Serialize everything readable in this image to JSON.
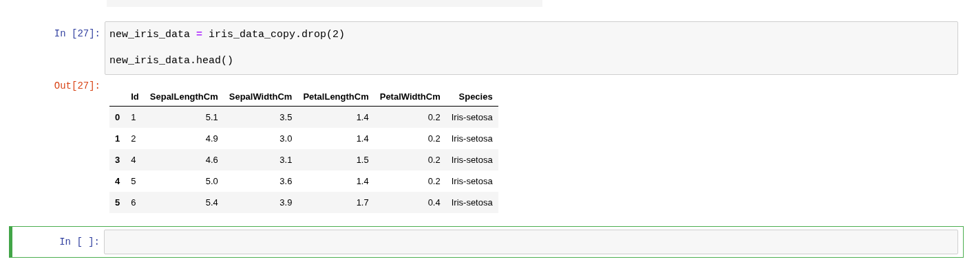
{
  "cells": [
    {
      "kind": "output_fragment"
    },
    {
      "kind": "code",
      "prompt": "In [27]:",
      "selected": false,
      "lines": [
        [
          {
            "text": "new_iris_data ",
            "kind": "name"
          },
          {
            "text": "=",
            "kind": "operator"
          },
          {
            "text": " iris_data_copy.drop(2)",
            "kind": "name"
          }
        ],
        [
          {
            "text": "new_iris_data.head()",
            "kind": "name"
          }
        ]
      ],
      "output": {
        "prompt": "Out[27]:",
        "columns": [
          "",
          "Id",
          "SepalLengthCm",
          "SepalWidthCm",
          "PetalLengthCm",
          "PetalWidthCm",
          "Species"
        ],
        "rows": [
          [
            "0",
            "1",
            "5.1",
            "3.5",
            "1.4",
            "0.2",
            "Iris-setosa"
          ],
          [
            "1",
            "2",
            "4.9",
            "3.0",
            "1.4",
            "0.2",
            "Iris-setosa"
          ],
          [
            "3",
            "4",
            "4.6",
            "3.1",
            "1.5",
            "0.2",
            "Iris-setosa"
          ],
          [
            "4",
            "5",
            "5.0",
            "3.6",
            "1.4",
            "0.2",
            "Iris-setosa"
          ],
          [
            "5",
            "6",
            "5.4",
            "3.9",
            "1.7",
            "0.4",
            "Iris-setosa"
          ]
        ]
      }
    },
    {
      "kind": "code",
      "prompt": "In [ ]:",
      "selected": true
    }
  ]
}
